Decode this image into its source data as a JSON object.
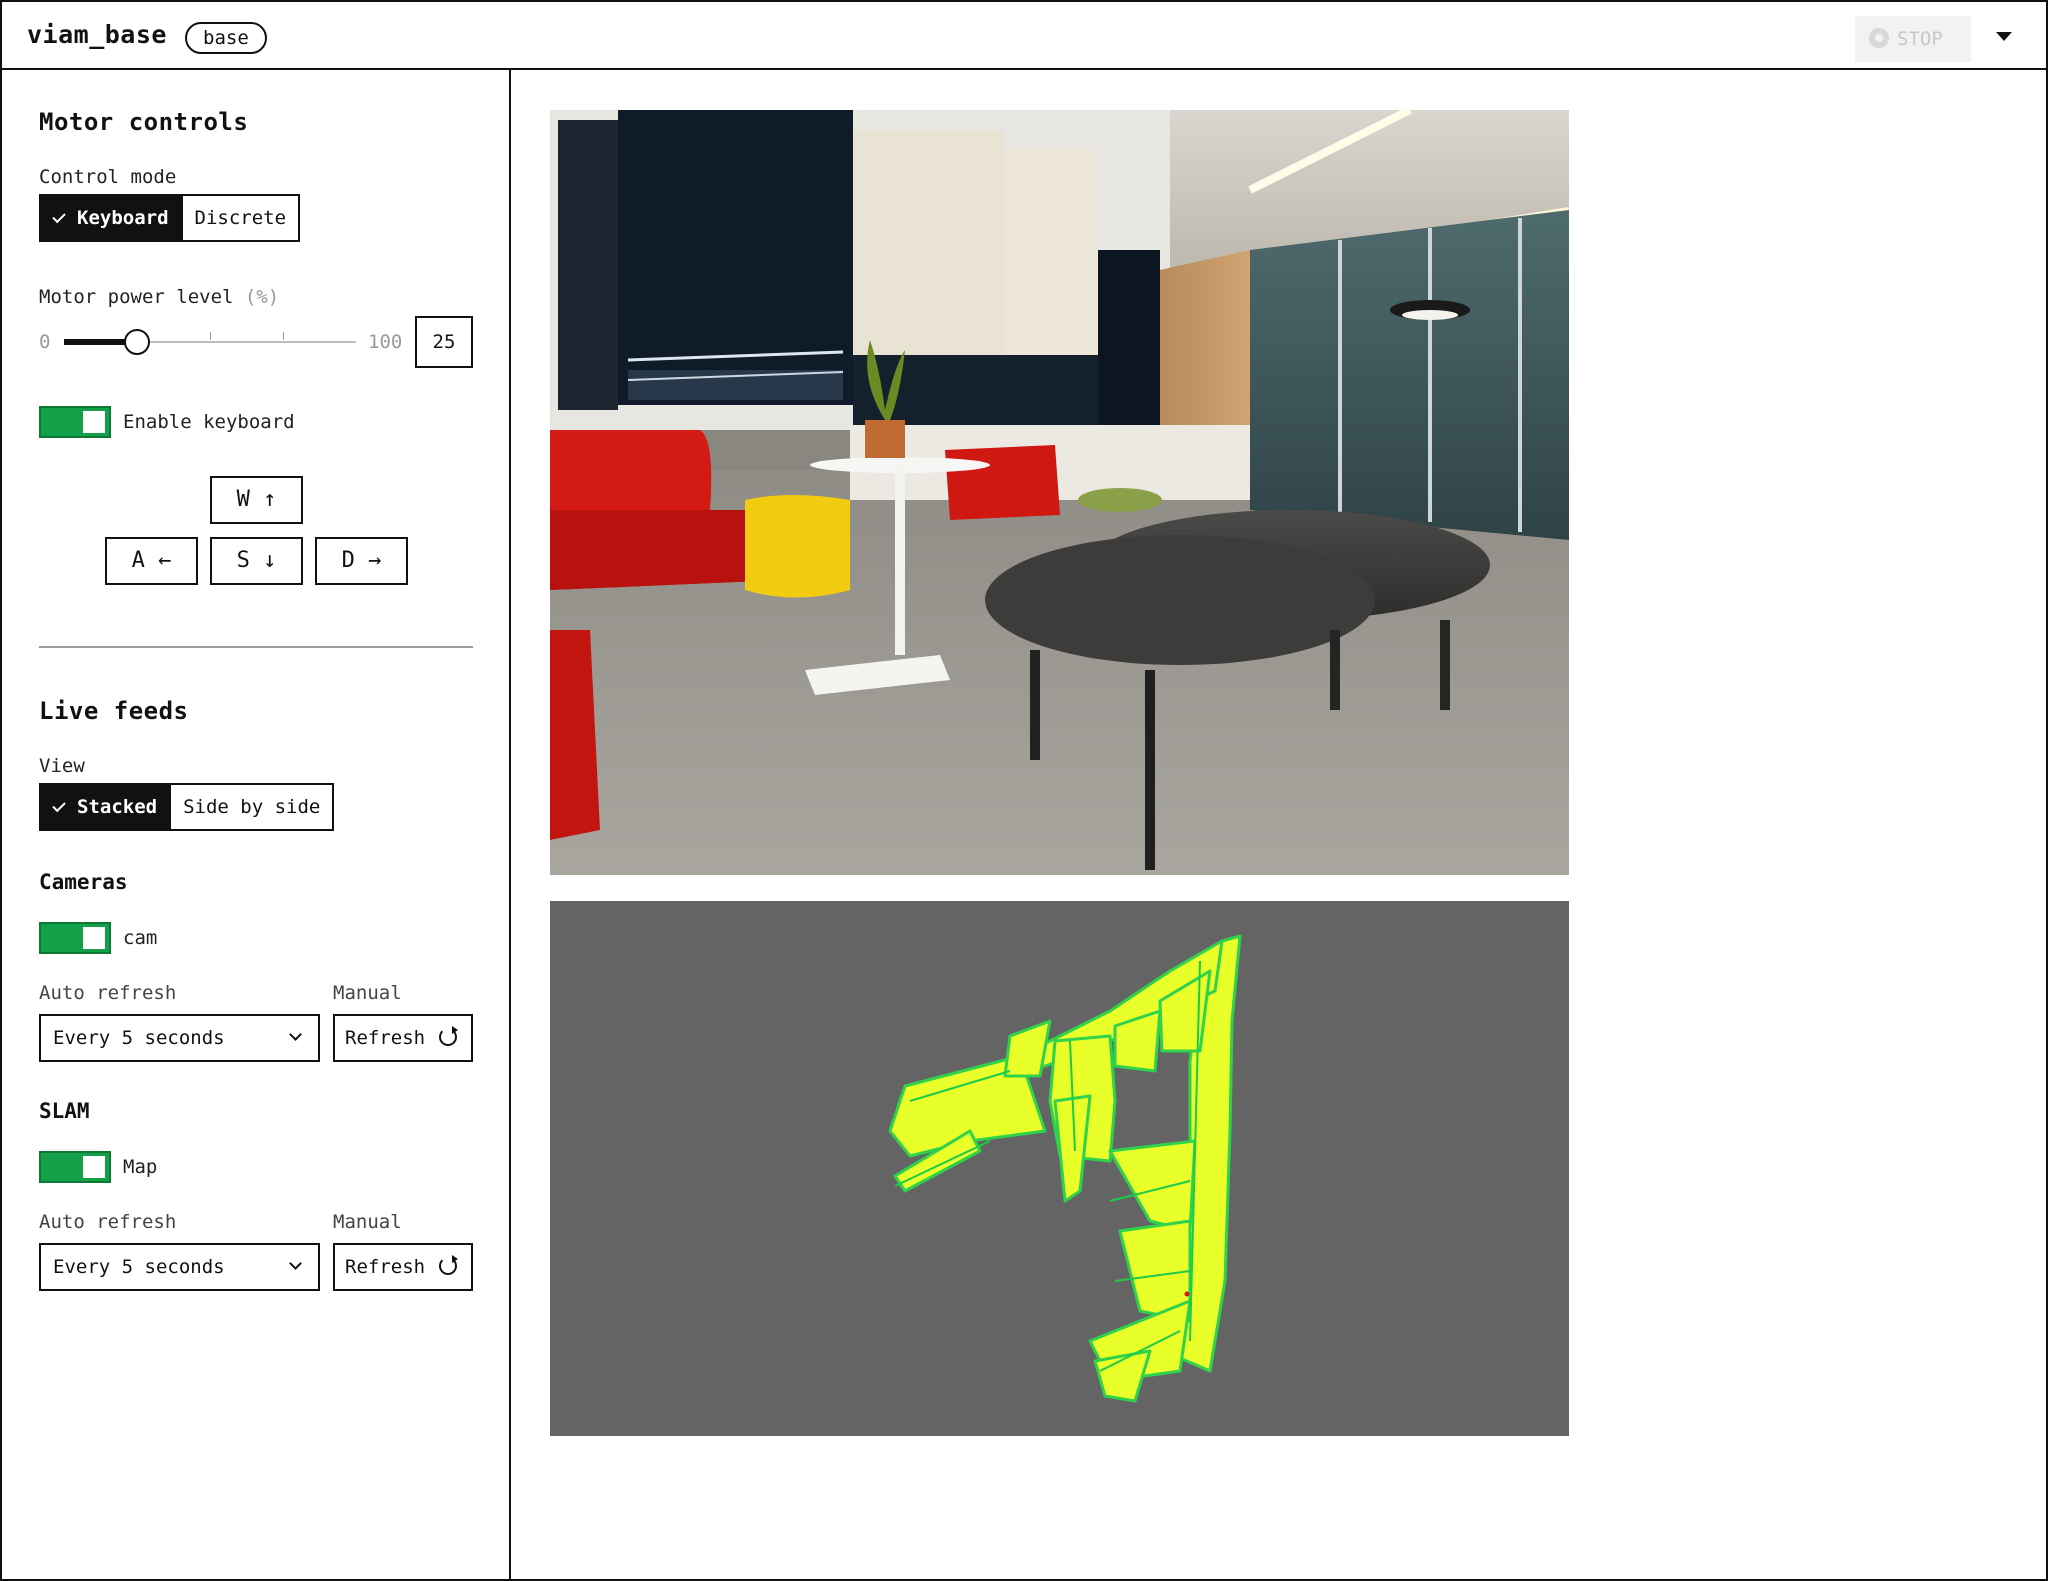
{
  "header": {
    "title": "viam_base",
    "badge": "base",
    "stop_label": "STOP"
  },
  "motor": {
    "heading": "Motor controls",
    "control_mode_label": "Control mode",
    "modes": [
      "Keyboard",
      "Discrete"
    ],
    "selected_mode": "Keyboard",
    "power_label": "Motor power level",
    "power_unit": "(%)",
    "slider_min": "0",
    "slider_max": "100",
    "power_value": "25",
    "power_fraction": 0.25,
    "enable_keyboard_label": "Enable keyboard",
    "enable_keyboard_on": true,
    "keys": {
      "w": "W ↑",
      "a": "A ←",
      "s": "S ↓",
      "d": "D →"
    }
  },
  "feeds": {
    "heading": "Live feeds",
    "view_label": "View",
    "views": [
      "Stacked",
      "Side by side"
    ],
    "selected_view": "Stacked",
    "cameras": {
      "heading": "Cameras",
      "toggle_label": "cam",
      "enabled": true,
      "auto_refresh_label": "Auto refresh",
      "auto_refresh_value": "Every 5 seconds",
      "manual_label": "Manual",
      "refresh_label": "Refresh"
    },
    "slam": {
      "heading": "SLAM",
      "toggle_label": "Map",
      "enabled": true,
      "auto_refresh_label": "Auto refresh",
      "auto_refresh_value": "Every 5 seconds",
      "manual_label": "Manual",
      "refresh_label": "Refresh"
    }
  },
  "colors": {
    "toggle_on": "#14a049",
    "map_bg": "#646464",
    "map_points": "#e8ff2a",
    "map_points_edge": "#2fd24a"
  }
}
